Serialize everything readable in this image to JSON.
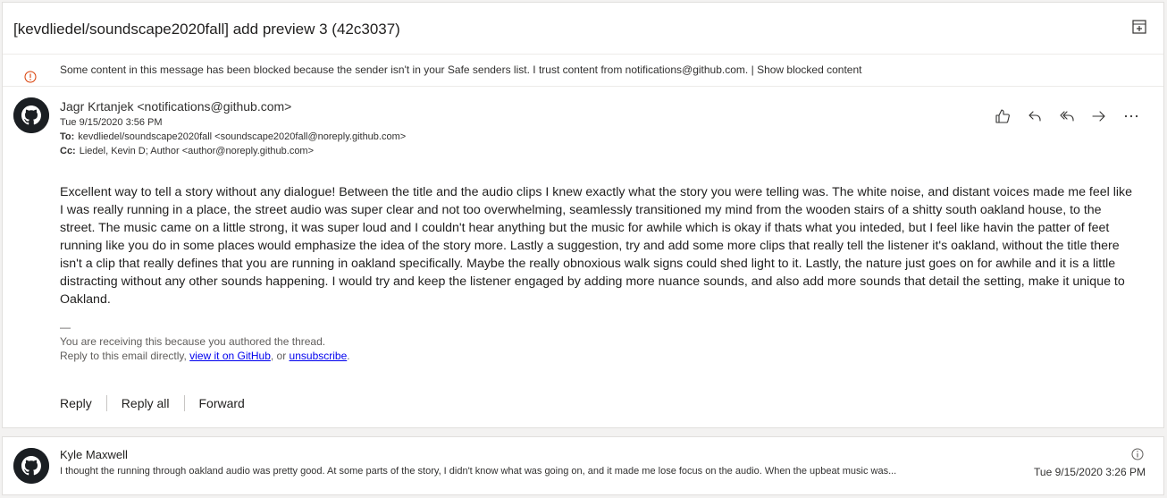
{
  "subject": "[kevdliedel/soundscape2020fall] add preview 3 (42c3037)",
  "blocked_notice": {
    "text": "Some content in this message has been blocked because the sender isn't in your Safe senders list.",
    "trust_link": "I trust content from notifications@github.com.",
    "separator": "|",
    "show_link": "Show blocked content"
  },
  "message": {
    "from": "Jagr Krtanjek <notifications@github.com>",
    "date": "Tue 9/15/2020 3:56 PM",
    "to_label": "To:",
    "to": "kevdliedel/soundscape2020fall <soundscape2020fall@noreply.github.com>",
    "cc_label": "Cc:",
    "cc": "Liedel, Kevin D; Author <author@noreply.github.com>",
    "body": "Excellent way to tell a story without any dialogue! Between the title and the audio clips I knew exactly what the story you were telling was. The white noise, and distant voices made me feel like I was really running in a place, the street audio was super clear and not too overwhelming, seamlessly transitioned my mind from the wooden stairs of a shitty south oakland house, to the street. The music came on a little strong, it was super loud and I couldn't hear anything but the music for awhile which is okay if thats what you inteded, but I feel like havin the patter of feet running like you do in some places would emphasize the idea of the story more. Lastly a suggestion, try and add some more clips that really tell the listener it's oakland, without the title there isn't a clip that really defines that you are running in oakland specifically. Maybe the really obnoxious walk signs could shed light to it. Lastly, the nature just goes on for awhile and it is a little distracting without any other sounds happening. I would try and keep the listener engaged by adding more nuance sounds, and also add more sounds that detail the setting, make it unique to Oakland.",
    "sig_dash": "—",
    "footer_line1": "You are receiving this because you authored the thread.",
    "footer_prefix": "Reply to this email directly, ",
    "footer_link1": "view it on GitHub",
    "footer_mid": ", or ",
    "footer_link2": "unsubscribe",
    "footer_suffix": "."
  },
  "actions": {
    "like_icon": "thumbs-up-icon",
    "reply_icon": "reply-icon",
    "reply_all_icon": "reply-all-icon",
    "forward_icon": "forward-icon",
    "more_icon": "more-icon"
  },
  "reply_bar": {
    "reply": "Reply",
    "reply_all": "Reply all",
    "forward": "Forward"
  },
  "second_message": {
    "from": "Kyle Maxwell",
    "preview": "I thought the running through oakland audio was pretty good. At some parts of the story, I didn't know what was going on, and it made me lose focus on the audio. When the upbeat music was...",
    "date": "Tue 9/15/2020 3:26 PM"
  },
  "colors": {
    "blocked_icon": "#d83b01",
    "link": "#0000ee",
    "avatar_bg": "#1b1f23"
  }
}
